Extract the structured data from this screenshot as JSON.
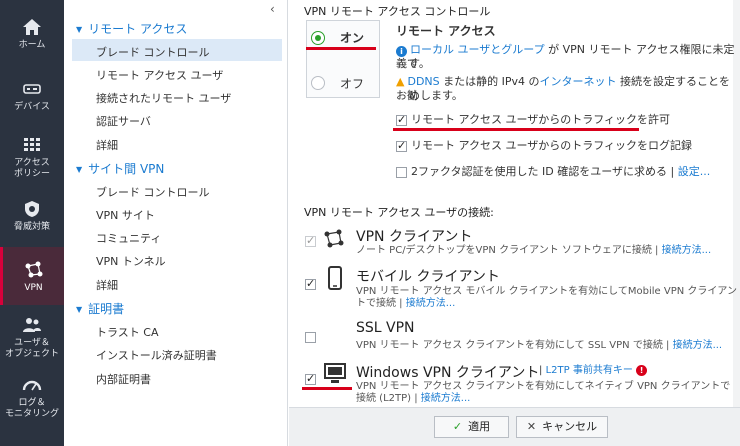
{
  "rail": {
    "items": [
      {
        "label1": "ホーム",
        "label2": "",
        "icon": "home-icon"
      },
      {
        "label1": "デバイス",
        "label2": "",
        "icon": "device-icon"
      },
      {
        "label1": "アクセス",
        "label2": "ポリシー",
        "icon": "grid-icon"
      },
      {
        "label1": "脅威対策",
        "label2": "",
        "icon": "shield-icon"
      },
      {
        "label1": "VPN",
        "label2": "",
        "icon": "vpn-icon"
      },
      {
        "label1": "ユーザ＆",
        "label2": "オブジェクト",
        "icon": "users-icon"
      },
      {
        "label1": "ログ＆",
        "label2": "モニタリング",
        "icon": "gauge-icon"
      }
    ]
  },
  "tree": {
    "sections": [
      {
        "title": "リモート アクセス",
        "items": [
          "ブレード コントロール",
          "リモート アクセス ユーザ",
          "接続されたリモート ユーザ",
          "認証サーバ",
          "詳細"
        ]
      },
      {
        "title": "サイト間 VPN",
        "items": [
          "ブレード コントロール",
          "VPN サイト",
          "コミュニティ",
          "VPN トンネル",
          "詳細"
        ]
      },
      {
        "title": "証明書",
        "items": [
          "トラスト CA",
          "インストール済み証明書",
          "内部証明書"
        ]
      }
    ]
  },
  "main": {
    "control_heading": "VPN リモート アクセス コントロール",
    "toggle_on": "オン",
    "toggle_off": "オフ",
    "ra_title": "リモート アクセス",
    "info_link": "ローカル ユーザとグループ",
    "info_text1": "が VPN リモート アクセス権限に未定義で",
    "info_text2": "す。",
    "warn_link1": "DDNS",
    "warn_mid": "または静的 IPv4 の",
    "warn_link2": "インターネット",
    "warn_text1": "接続を設定することをお勧",
    "warn_text2": "めします。",
    "opt_allow_traffic": "リモート アクセス ユーザからのトラフィックを許可",
    "opt_log_traffic": "リモート アクセス ユーザからのトラフィックをログ記録",
    "opt_2fa": "2ファクタ認証を使用した ID 確認をユーザに求める",
    "opt_2fa_link": "設定...",
    "conn_heading": "VPN リモート アクセス ユーザの接続:",
    "clients": [
      {
        "title": "VPN クライアント",
        "desc1": "ノート PC/デスクトップをVPN クライアント ソフトウェアに接続",
        "desc2": "",
        "link": "接続方法..."
      },
      {
        "title": "モバイル クライアント",
        "desc1": "VPN リモート アクセス モバイル クライアントを有効にしてMobile VPN クライアン",
        "desc2": "トで接続",
        "link": "接続方法..."
      },
      {
        "title": "SSL VPN",
        "desc1": "VPN リモート アクセス クライアントを有効にして SSL VPN で接続",
        "desc2": "",
        "link": "接続方法..."
      },
      {
        "title": "Windows VPN クライアント",
        "desc1": "VPN リモート アクセス クライアントを有効にしてネイティブ VPN クライアントで",
        "desc2": "接続 (L2TP)",
        "link": "接続方法...",
        "extra_link": "L2TP 事前共有キー"
      }
    ],
    "apply_label": "適用",
    "cancel_label": "キャンセル"
  }
}
